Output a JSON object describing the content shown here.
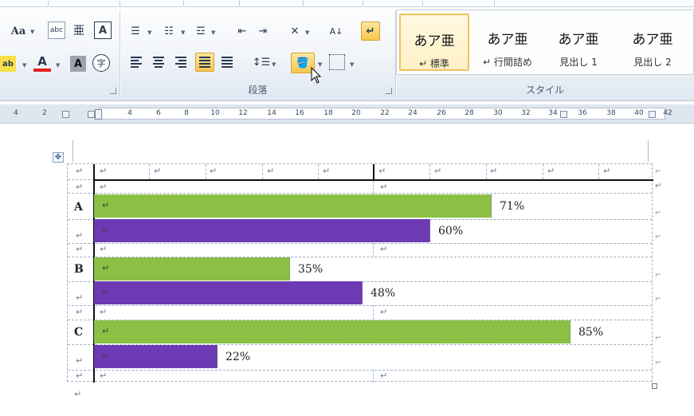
{
  "ribbon": {
    "font_group": {
      "font_size_button": "Aa",
      "ruby_button": "亜",
      "font_color_button": "A",
      "char_shading_button": "A",
      "enclose_char_button": "字"
    },
    "paragraph_group": {
      "label": "段落"
    },
    "styles_group": {
      "label": "スタイル",
      "items": [
        {
          "sample": "あア亜",
          "name": "↵ 標準",
          "selected": true
        },
        {
          "sample": "あア亜",
          "name": "↵ 行間詰め",
          "selected": false
        },
        {
          "sample": "あア亜",
          "name": "見出し 1",
          "selected": false
        },
        {
          "sample": "あア亜",
          "name": "見出し 2",
          "selected": false
        }
      ]
    }
  },
  "ruler": {
    "left_ticks": [
      "4",
      "2"
    ],
    "ticks": [
      "4",
      "6",
      "8",
      "10",
      "12",
      "14",
      "16",
      "18",
      "20",
      "22",
      "24",
      "26",
      "28",
      "30",
      "32",
      "34",
      "36",
      "38",
      "40",
      "42"
    ]
  },
  "document": {
    "paragraph_mark": "↵",
    "table": {
      "groups": [
        {
          "label": "A",
          "bars": [
            {
              "value_label": "71%",
              "value": 71,
              "color": "#8bc045"
            },
            {
              "value_label": "60%",
              "value": 60,
              "color": "#6d3ab4"
            }
          ]
        },
        {
          "label": "B",
          "bars": [
            {
              "value_label": "35%",
              "value": 35,
              "color": "#8bc045"
            },
            {
              "value_label": "48%",
              "value": 48,
              "color": "#6d3ab4"
            }
          ]
        },
        {
          "label": "C",
          "bars": [
            {
              "value_label": "85%",
              "value": 85,
              "color": "#8bc045"
            },
            {
              "value_label": "22%",
              "value": 22,
              "color": "#6d3ab4"
            }
          ]
        }
      ]
    }
  },
  "colors": {
    "green_bar": "#8bc045",
    "purple_bar": "#6d3ab4",
    "highlight": "#f7c64f",
    "font_color_underline": "#e02020"
  }
}
